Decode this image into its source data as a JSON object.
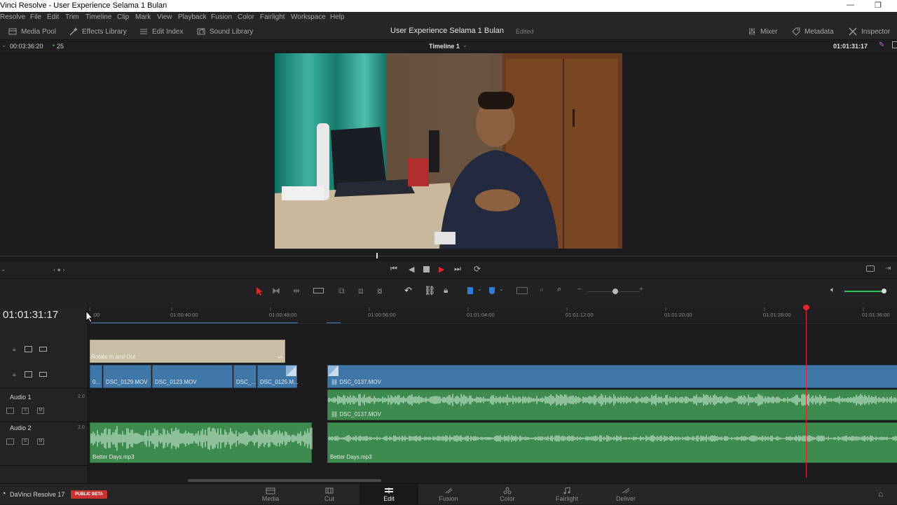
{
  "window": {
    "title": "Vinci Resolve - User Experience Selama 1 Bulan",
    "minimize": "—",
    "maximize": "❐"
  },
  "menu": [
    "Resolve",
    "File",
    "Edit",
    "Trim",
    "Timeline",
    "Clip",
    "Mark",
    "View",
    "Playback",
    "Fusion",
    "Color",
    "Fairlight",
    "Workspace",
    "Help"
  ],
  "toolbar": {
    "media_pool": "Media Pool",
    "effects_library": "Effects Library",
    "edit_index": "Edit Index",
    "sound_library": "Sound Library",
    "project_title": "User Experience Selama 1 Bulan",
    "project_status": "Edited",
    "mixer": "Mixer",
    "metadata": "Metadata",
    "inspector": "Inspector"
  },
  "viewer": {
    "duration_tc": "00:03:36:20",
    "fps": "25",
    "timeline_name": "Timeline 1",
    "current_tc": "01:01:31:17"
  },
  "timeline": {
    "big_timecode": "01:01:31:17",
    "ruler": [
      ":00",
      "01:00:40:00",
      "01:00:48:00",
      "01:00:56:00",
      "01:01:04:00",
      "01:01:12:00",
      "01:01:20:00",
      "01:01:28:00",
      "01:01:36:00"
    ],
    "title_clip": "Rotate In and Out",
    "video_clips": [
      "0...",
      "DSC_0129.MOV",
      "DSC_0123.MOV",
      "DSC_...",
      "DSC_0125.M...",
      "DSC_0137.MOV"
    ],
    "audio_tracks": [
      {
        "name": "Audio 1",
        "level": "2.0"
      },
      {
        "name": "Audio 2",
        "level": "2.0"
      }
    ],
    "audio1_clip": "DSC_0137.MOV",
    "audio2_clips": [
      "Better Days.mp3",
      "Better Days.mp3"
    ],
    "btn_solo": "S",
    "btn_mute": "M"
  },
  "footer": {
    "app_name": "DaVinci Resolve 17",
    "beta_badge": "PUBLIC BETA",
    "pages": [
      "Media",
      "Cut",
      "Edit",
      "Fusion",
      "Color",
      "Fairlight",
      "Deliver"
    ],
    "active_page": "Edit"
  },
  "colors": {
    "video_clip": "#3f78a8",
    "audio_clip": "#3e8b4f",
    "title_clip": "#c9bfa7",
    "playhead": "#e0262b",
    "beta_badge": "#c8322f"
  }
}
